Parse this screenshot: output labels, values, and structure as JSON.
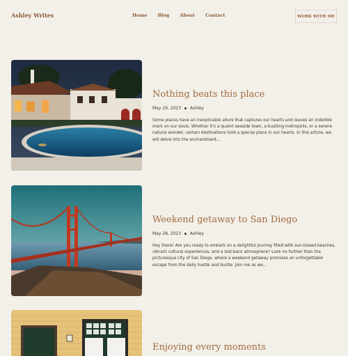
{
  "header": {
    "brand": "Ashley Writes",
    "nav": [
      "Home",
      "Blog",
      "About",
      "Contact"
    ],
    "cta": "WORK WITH ME"
  },
  "posts": [
    {
      "title": "Nothing beats this place",
      "date": "May 29, 2023",
      "author": "Ashley",
      "excerpt": "Some places have an inexplicable allure that captures our hearts and leaves an indelible mark on our souls. Whether it's a quaint seaside town, a bustling metropolis, or a serene natural wonder, certain destinations hold a special place in our hearts. In this article, we will delve into the enchantment..."
    },
    {
      "title": "Weekend getaway to San Diego",
      "date": "May 28, 2023",
      "author": "Ashley",
      "excerpt": "Hey there! Are you ready to embark on a delightful journey filled with sun-kissed beaches, vibrant cultural experiences, and a laid-back atmosphere? Look no further than the picturesque city of San Diego, where a weekend getaway promises an unforgettable escape from the daily hustle and bustle. Join me as we..."
    },
    {
      "title": "Enjoying every moments"
    }
  ],
  "colors": {
    "background": "#f3f0ea",
    "accent": "#a06a3c",
    "brand": "#8a5a35"
  }
}
